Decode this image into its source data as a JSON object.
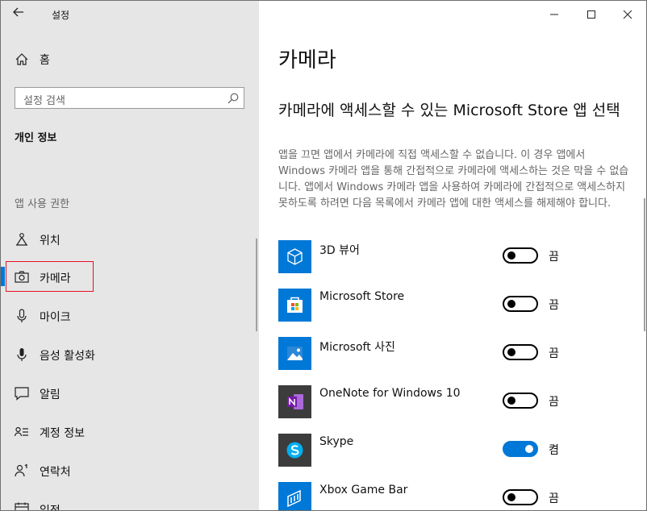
{
  "window": {
    "title": "설정",
    "controls": [
      "minimize-icon",
      "maximize-icon",
      "close-icon"
    ]
  },
  "sidebar": {
    "home_label": "홈",
    "search_placeholder": "설정 검색",
    "group_title": "개인 정보",
    "section_title": "앱 사용 권한",
    "items": [
      {
        "label": "위치",
        "icon": "location-icon"
      },
      {
        "label": "카메라",
        "icon": "camera-icon",
        "selected": true
      },
      {
        "label": "마이크",
        "icon": "microphone-icon"
      },
      {
        "label": "음성 활성화",
        "icon": "voice-activation-icon"
      },
      {
        "label": "알림",
        "icon": "notification-icon"
      },
      {
        "label": "계정 정보",
        "icon": "account-info-icon"
      },
      {
        "label": "연락처",
        "icon": "contacts-icon"
      },
      {
        "label": "일정",
        "icon": "calendar-icon"
      }
    ]
  },
  "main": {
    "title": "카메라",
    "subtitle": "카메라에 액세스할 수 있는 Microsoft Store 앱 선택",
    "description": "앱을 끄면 앱에서 카메라에 직접 액세스할 수 없습니다. 이 경우 앱에서 Windows 카메라 앱을 통해 간접적으로 카메라에 액세스하는 것은 막을 수 없습니다. 앱에서 Windows 카메라 앱을 사용하여 카메라에 간접적으로 액세스하지 못하도록 하려면 다음 목록에서 카메라 앱에 대한 액세스를 해제해야 합니다.",
    "apps": [
      {
        "name": "3D 뷰어",
        "state": "끔",
        "on": false,
        "icon": "3d-viewer-icon",
        "tile_color": "#0078d7"
      },
      {
        "name": "Microsoft Store",
        "state": "끔",
        "on": false,
        "icon": "microsoft-store-icon",
        "tile_color": "#0078d7"
      },
      {
        "name": "Microsoft 사진",
        "state": "끔",
        "on": false,
        "icon": "photos-icon",
        "tile_color": "#0078d7"
      },
      {
        "name": "OneNote for Windows 10",
        "state": "끔",
        "on": false,
        "icon": "onenote-icon",
        "tile_color": "#3c3c3c"
      },
      {
        "name": "Skype",
        "state": "켬",
        "on": true,
        "icon": "skype-icon",
        "tile_color": "#3c3c3c"
      },
      {
        "name": "Xbox Game Bar",
        "state": "끔",
        "on": false,
        "icon": "xbox-game-bar-icon",
        "tile_color": "#0078d7"
      }
    ]
  },
  "colors": {
    "accent": "#0078d7",
    "selection_outline": "#e81123",
    "sidebar_bg": "#e6e6e6"
  }
}
